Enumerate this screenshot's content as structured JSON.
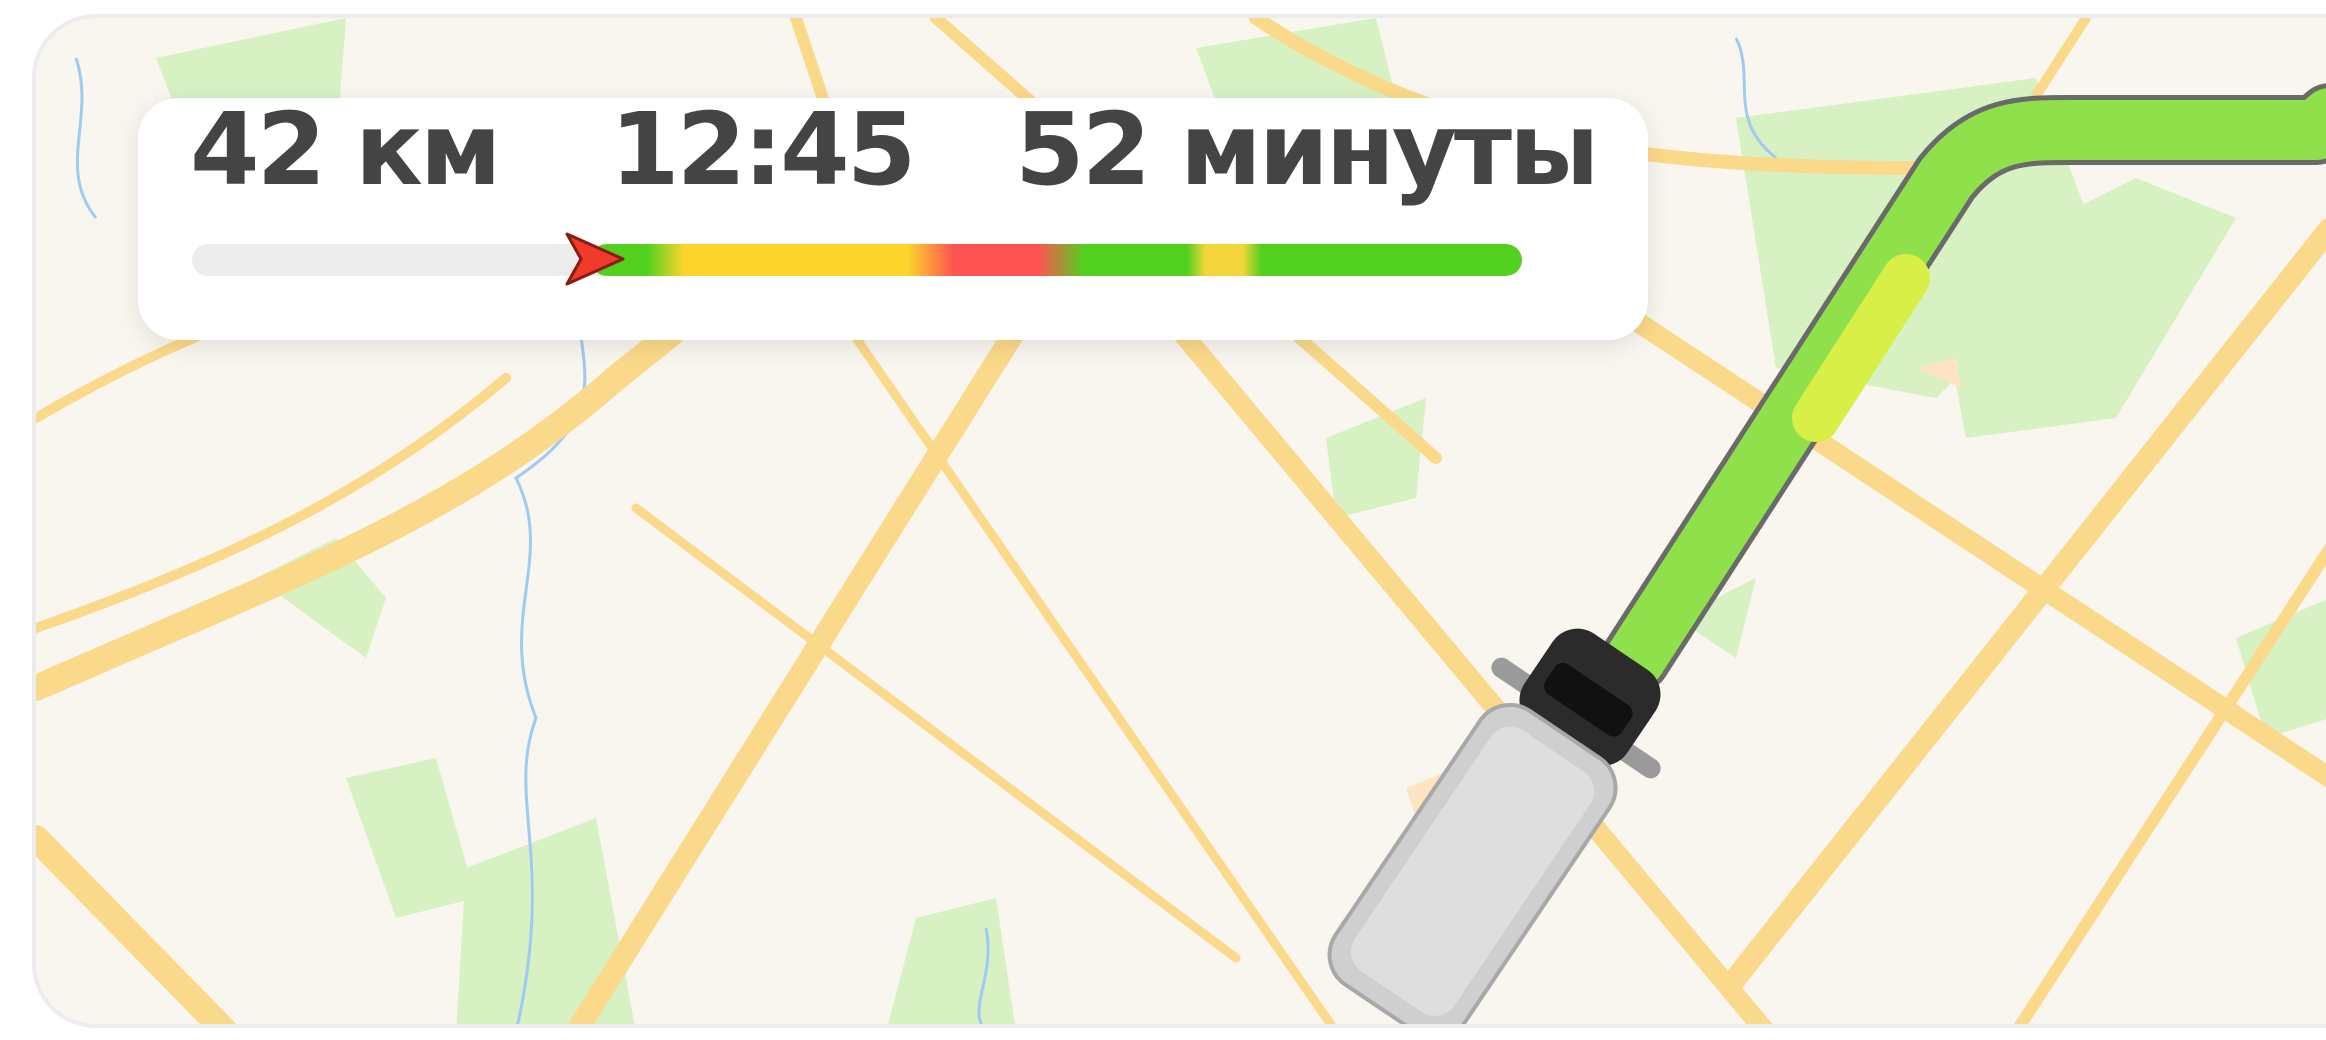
{
  "route_summary": {
    "distance": "42 км",
    "arrival_time": "12:45",
    "duration": "52 минуты",
    "progress_fraction": 0.3,
    "traffic_colors": {
      "free": "#51d11e",
      "moderate": "#fdd42c",
      "heavy": "#ff5252",
      "untraveled": "#ececec"
    }
  },
  "map": {
    "route_line_color": "#8fe04a",
    "vehicle": "truck-icon",
    "marker": "current-position-arrow-icon"
  }
}
